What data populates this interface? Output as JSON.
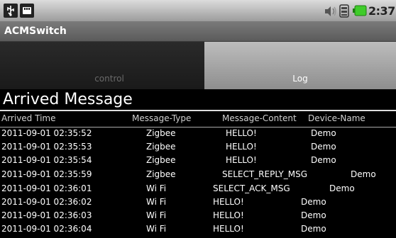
{
  "status_bar": {
    "time": "2:37",
    "icons": [
      "usb-icon",
      "sd-card-icon",
      "volume-icon",
      "signal-icon",
      "battery-icon"
    ],
    "battery_color": "#3fcc2a"
  },
  "app": {
    "title": "ACMSwitch"
  },
  "tabs": [
    {
      "label": "control",
      "selected": false
    },
    {
      "label": "Log",
      "selected": true
    }
  ],
  "log": {
    "heading": "Arrived Message",
    "columns": [
      "Arrived Time",
      "Message-Type",
      "Message-Content",
      "Device-Name"
    ],
    "rows": [
      {
        "time": "2011-09-01 02:35:52",
        "type": "Zigbee",
        "content": "HELLO!",
        "device": "Demo"
      },
      {
        "time": "2011-09-01 02:35:53",
        "type": "Zigbee",
        "content": "HELLO!",
        "device": "Demo"
      },
      {
        "time": "2011-09-01 02:35:54",
        "type": "Zigbee",
        "content": "HELLO!",
        "device": "Demo"
      },
      {
        "time": "2011-09-01 02:35:59",
        "type": "Zigbee",
        "content": "SELECT_REPLY_MSG",
        "device": "Demo"
      },
      {
        "time": "2011-09-01 02:36:01",
        "type": "Wi Fi",
        "content": "SELECT_ACK_MSG",
        "device": "Demo"
      },
      {
        "time": "2011-09-01 02:36:02",
        "type": "Wi Fi",
        "content": "HELLO!",
        "device": "Demo"
      },
      {
        "time": "2011-09-01 02:36:03",
        "type": "Wi Fi",
        "content": "HELLO!",
        "device": "Demo"
      },
      {
        "time": "2011-09-01 02:36:04",
        "type": "Wi Fi",
        "content": "HELLO!",
        "device": "Demo"
      }
    ]
  }
}
